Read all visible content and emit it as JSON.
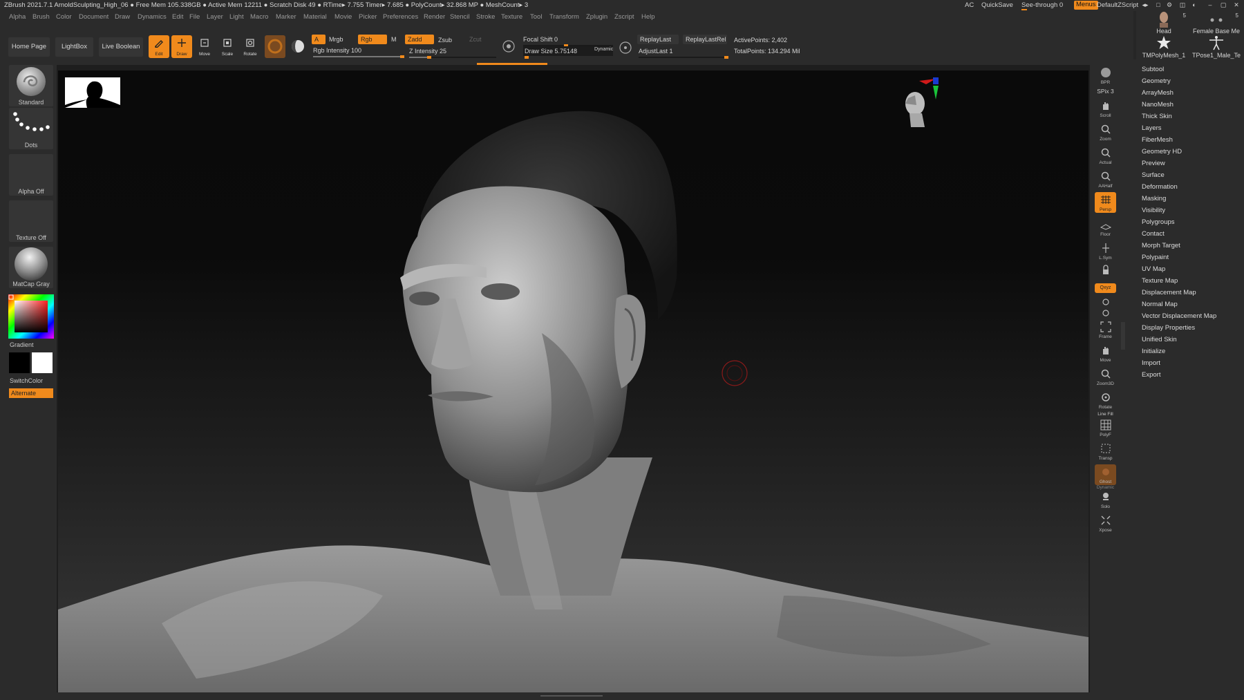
{
  "titlebar": {
    "title": "ZBrush 2021.7.1   ArnoldSculpting_High_06   ● Free Mem 105.338GB ● Active Mem 12211 ● Scratch Disk 49 ●  RTime▸ 7.755 Timer▸ 7.685 ● PolyCount▸ 32.868 MP  ● MeshCount▸ 3",
    "ac": "AC",
    "quicksave": "QuickSave",
    "see_through": "See-through  0",
    "menus": "Menus",
    "default_zscript": "DefaultZScript"
  },
  "menubar": [
    "Alpha",
    "Brush",
    "Color",
    "Document",
    "Draw",
    "Dynamics",
    "Edit",
    "File",
    "Layer",
    "Light",
    "Macro",
    "Marker",
    "Material",
    "Movie",
    "Picker",
    "Preferences",
    "Render",
    "Stencil",
    "Stroke",
    "Texture",
    "Tool",
    "Transform",
    "Zplugin",
    "Zscript",
    "Help"
  ],
  "tool_thumbs": [
    {
      "label": "Head",
      "count": "5"
    },
    {
      "label": "Female Base Me",
      "count": "5"
    },
    {
      "label": "TMPolyMesh_1",
      "count": ""
    },
    {
      "label": "TPose1_Male_Te",
      "count": ""
    }
  ],
  "shelf": {
    "home_page": "Home Page",
    "lightbox": "LightBox",
    "live_boolean": "Live Boolean",
    "edit": "Edit",
    "draw": "Draw",
    "move": "Move",
    "scale": "Scale",
    "rotate": "Rotate",
    "a": "A",
    "mrgb": "Mrgb",
    "rgb": "Rgb",
    "m": "M",
    "zadd": "Zadd",
    "zsub": "Zsub",
    "zcut": "Zcut",
    "rgb_intensity": "Rgb Intensity 100",
    "z_intensity": "Z Intensity 25",
    "focal_shift": "Focal Shift 0",
    "draw_size": "Draw Size 5.75148",
    "dynamic": "Dynamic",
    "replay_last": "ReplayLast",
    "replay_last_rel": "ReplayLastRel",
    "adjust_last": "AdjustLast 1",
    "active_points": "ActivePoints: 2,402",
    "total_points": "TotalPoints: 134.294 Mil"
  },
  "left_tray": {
    "brush": "Standard",
    "stroke": "Dots",
    "alpha": "Alpha Off",
    "texture": "Texture Off",
    "material": "MatCap Gray",
    "gradient": "Gradient",
    "switch_color": "SwitchColor",
    "alternate": "Alternate"
  },
  "right_shelf": {
    "bpr": "BPR",
    "spix": "SPix 3",
    "scroll": "Scroll",
    "zoom": "Zoom",
    "actual": "Actual",
    "aahalf": "AAHalf",
    "persp": "Persp",
    "floor": "Floor",
    "lsym": "L.Sym",
    "xyz": "Qxyz",
    "frame": "Frame",
    "move": "Move",
    "zoom3d": "Zoom3D",
    "rotate": "Rotate",
    "line_fill": "Line Fill",
    "polyf": "PolyF",
    "transp": "Transp",
    "ghost": "Ghost",
    "dynamic": "Dynamic",
    "solo": "Solo",
    "xpose": "Xpose"
  },
  "tool_palette": [
    "Subtool",
    "Geometry",
    "ArrayMesh",
    "NanoMesh",
    "Thick Skin",
    "Layers",
    "FiberMesh",
    "Geometry HD",
    "Preview",
    "Surface",
    "Deformation",
    "Masking",
    "Visibility",
    "Polygroups",
    "Contact",
    "Morph Target",
    "Polypaint",
    "UV Map",
    "Texture Map",
    "Displacement Map",
    "Normal Map",
    "Vector Displacement Map",
    "Display Properties",
    "Unified Skin",
    "Initialize",
    "Import",
    "Export"
  ],
  "colors": {
    "accent": "#f08a1c",
    "panel": "#2b2b2b",
    "button": "#353535"
  },
  "values": {
    "rgb_intensity_pct": 100,
    "z_intensity_pct": 25,
    "focal_shift_pct": 50,
    "draw_size_pct": 6,
    "adjust_last_pct": 100
  }
}
